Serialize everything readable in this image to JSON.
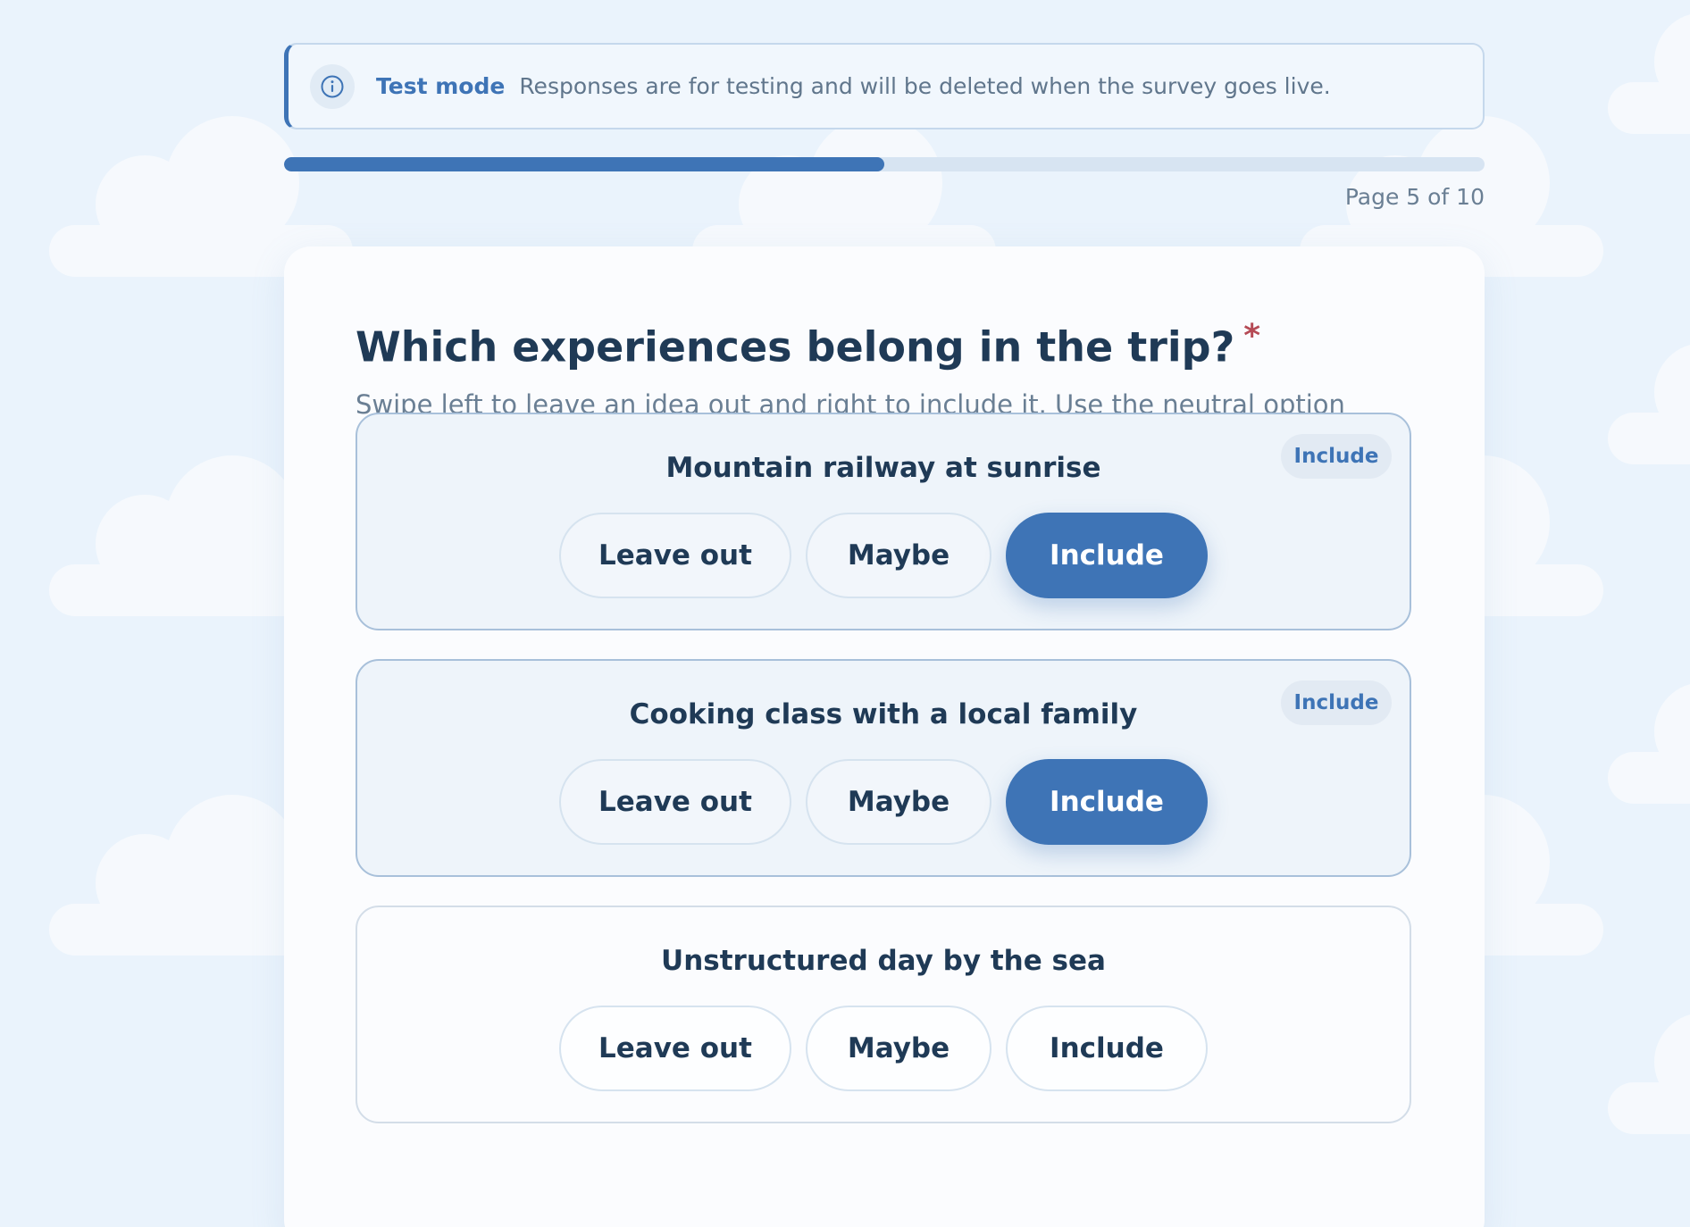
{
  "banner": {
    "icon": "info-icon",
    "title": "Test mode",
    "text": "Responses are for testing and will be deleted when the survey goes live."
  },
  "progress": {
    "fraction": 0.5,
    "label": "Page 5 of 10"
  },
  "question": {
    "title": "Which experiences belong in the trip?",
    "required_marker": "*",
    "description": "Swipe left to leave an idea out and right to include it. Use the neutral option when you are undecided."
  },
  "options": [
    "Leave out",
    "Maybe",
    "Include"
  ],
  "items": [
    {
      "label": "Mountain railway at sunrise",
      "selected": "Include",
      "badge": "Include"
    },
    {
      "label": "Cooking class with a local family",
      "selected": "Include",
      "badge": "Include"
    },
    {
      "label": "Unstructured day by the sea",
      "selected": "",
      "badge": ""
    }
  ],
  "colors": {
    "accent": "#3e74b6",
    "required": "#b54a55",
    "background": "#eaf3fc"
  }
}
